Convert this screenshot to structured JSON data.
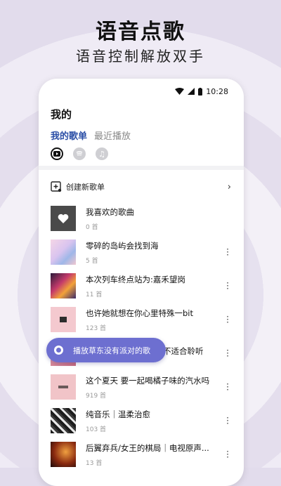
{
  "hero": {
    "title": "语音点歌",
    "subtitle": "语音控制解放双手"
  },
  "statusbar": {
    "time": "10:28"
  },
  "page": {
    "title": "我的"
  },
  "tabs": [
    {
      "label": "我的歌单",
      "active": true
    },
    {
      "label": "最近播放",
      "active": false
    }
  ],
  "sources": [
    "youtube-icon",
    "spotify-icon",
    "apple-music-icon"
  ],
  "create_playlist": {
    "label": "创建新歌单",
    "icon": "add-playlist-icon"
  },
  "playlists": [
    {
      "name": "我喜欢的歌曲",
      "count": "0 首"
    },
    {
      "name": "零碎的岛屿会找到海",
      "count": "5 首"
    },
    {
      "name": "本次列车终点站为:嘉禾望岗",
      "count": "11 首"
    },
    {
      "name": "也许她就想在你心里特殊一bit",
      "count": "123 首"
    },
    {
      "name": "不适合聆听",
      "count": ""
    },
    {
      "name": "这个夏天 要一起喝橘子味的汽水吗",
      "count": "919 首"
    },
    {
      "name": "纯音乐｜温柔治愈",
      "count": "103 首"
    },
    {
      "name": "后翼弃兵/女王的棋局｜电视原声...",
      "count": "13 首"
    }
  ],
  "voice_command": {
    "text": "播放草东没有派对的歌"
  },
  "colors": {
    "accent": "#2a4ea6",
    "pill": "#6d6fd0"
  }
}
